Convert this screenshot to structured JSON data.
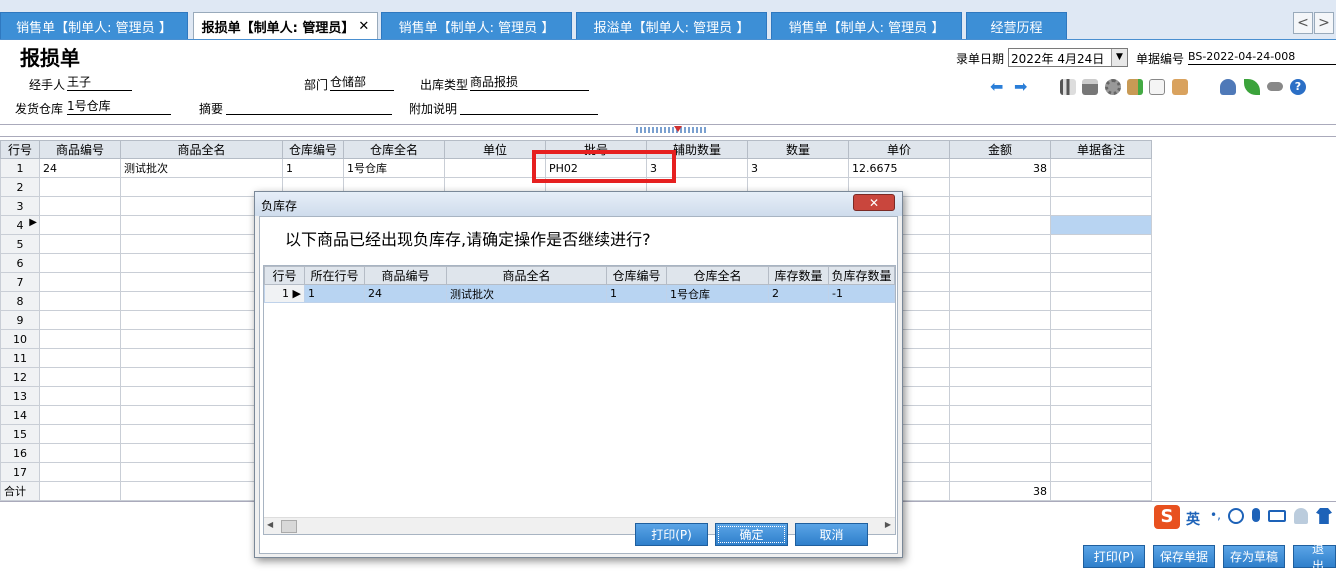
{
  "tabs": [
    {
      "label": "销售单【制单人: 管理员 】",
      "active": false
    },
    {
      "label": "报损单【制单人: 管理员】",
      "active": true
    },
    {
      "label": "销售单【制单人: 管理员 】",
      "active": false
    },
    {
      "label": "报溢单【制单人: 管理员 】",
      "active": false
    },
    {
      "label": "销售单【制单人: 管理员 】",
      "active": false
    },
    {
      "label": "经营历程",
      "active": false
    }
  ],
  "tab_close": "✕",
  "nav": {
    "prev": "<",
    "next": ">"
  },
  "form": {
    "title": "报损单",
    "date_label": "录单日期",
    "date_value": "2022年 4月24日",
    "billno_label": "单据编号",
    "billno_value": "BS-2022-04-24-008",
    "handler_label": "经手人",
    "handler_value": "王子",
    "dept_label": "部门",
    "dept_value": "仓储部",
    "outtype_label": "出库类型",
    "outtype_value": "商品报损",
    "warehouse_label": "发货仓库",
    "warehouse_value": "1号仓库",
    "summary_label": "摘要",
    "summary_value": "",
    "note_label": "附加说明",
    "note_value": ""
  },
  "toolbar_icons": [
    "arrow-left-icon",
    "arrow-right-icon",
    "chart-icon",
    "printer-icon",
    "gear-icon",
    "box-add-icon",
    "edit-icon",
    "box-icon",
    "user-icon",
    "leaf-icon",
    "link-icon",
    "help-icon"
  ],
  "grid": {
    "headers": [
      "行号",
      "商品编号",
      "商品全名",
      "仓库编号",
      "仓库全名",
      "单位",
      "批号",
      "辅助数量",
      "数量",
      "单价",
      "金额",
      "单据备注"
    ],
    "rows": [
      {
        "no": "1",
        "code": "24",
        "name": "测试批次",
        "wh_code": "1",
        "wh_name": "1号仓库",
        "unit": "",
        "batch": "PH02",
        "aux_qty": "3",
        "qty": "3",
        "price": "12.6675",
        "amount": "38",
        "remark": ""
      },
      {
        "no": "2"
      },
      {
        "no": "3"
      },
      {
        "no": "4",
        "current": true
      },
      {
        "no": "5"
      },
      {
        "no": "6"
      },
      {
        "no": "7"
      },
      {
        "no": "8"
      },
      {
        "no": "9"
      },
      {
        "no": "10"
      },
      {
        "no": "11"
      },
      {
        "no": "12"
      },
      {
        "no": "13"
      },
      {
        "no": "14"
      },
      {
        "no": "15"
      },
      {
        "no": "16"
      },
      {
        "no": "17"
      }
    ],
    "total_label": "合计",
    "total_amount": "38"
  },
  "dialog": {
    "title": "负库存",
    "close": "✕",
    "message": "以下商品已经出现负库存,请确定操作是否继续进行?",
    "headers": [
      "行号",
      "所在行号",
      "商品编号",
      "商品全名",
      "仓库编号",
      "仓库全名",
      "库存数量",
      "负库存数量"
    ],
    "rows": [
      {
        "no": "1",
        "row": "1",
        "code": "24",
        "name": "测试批次",
        "wh_code": "1",
        "wh_name": "1号仓库",
        "stock": "2",
        "neg": "-1"
      }
    ],
    "buttons": {
      "print": "打印(P)",
      "ok": "确定",
      "cancel": "取消"
    }
  },
  "bottom_buttons": {
    "print": "打印(P)",
    "save": "保存单据",
    "draft": "存为草稿",
    "exit": "退出"
  },
  "ime": {
    "lang": "英"
  },
  "colors": {
    "tab_bg": "#3d8fd6",
    "highlight_box": "#e62020",
    "selection": "#b8d4f2"
  }
}
